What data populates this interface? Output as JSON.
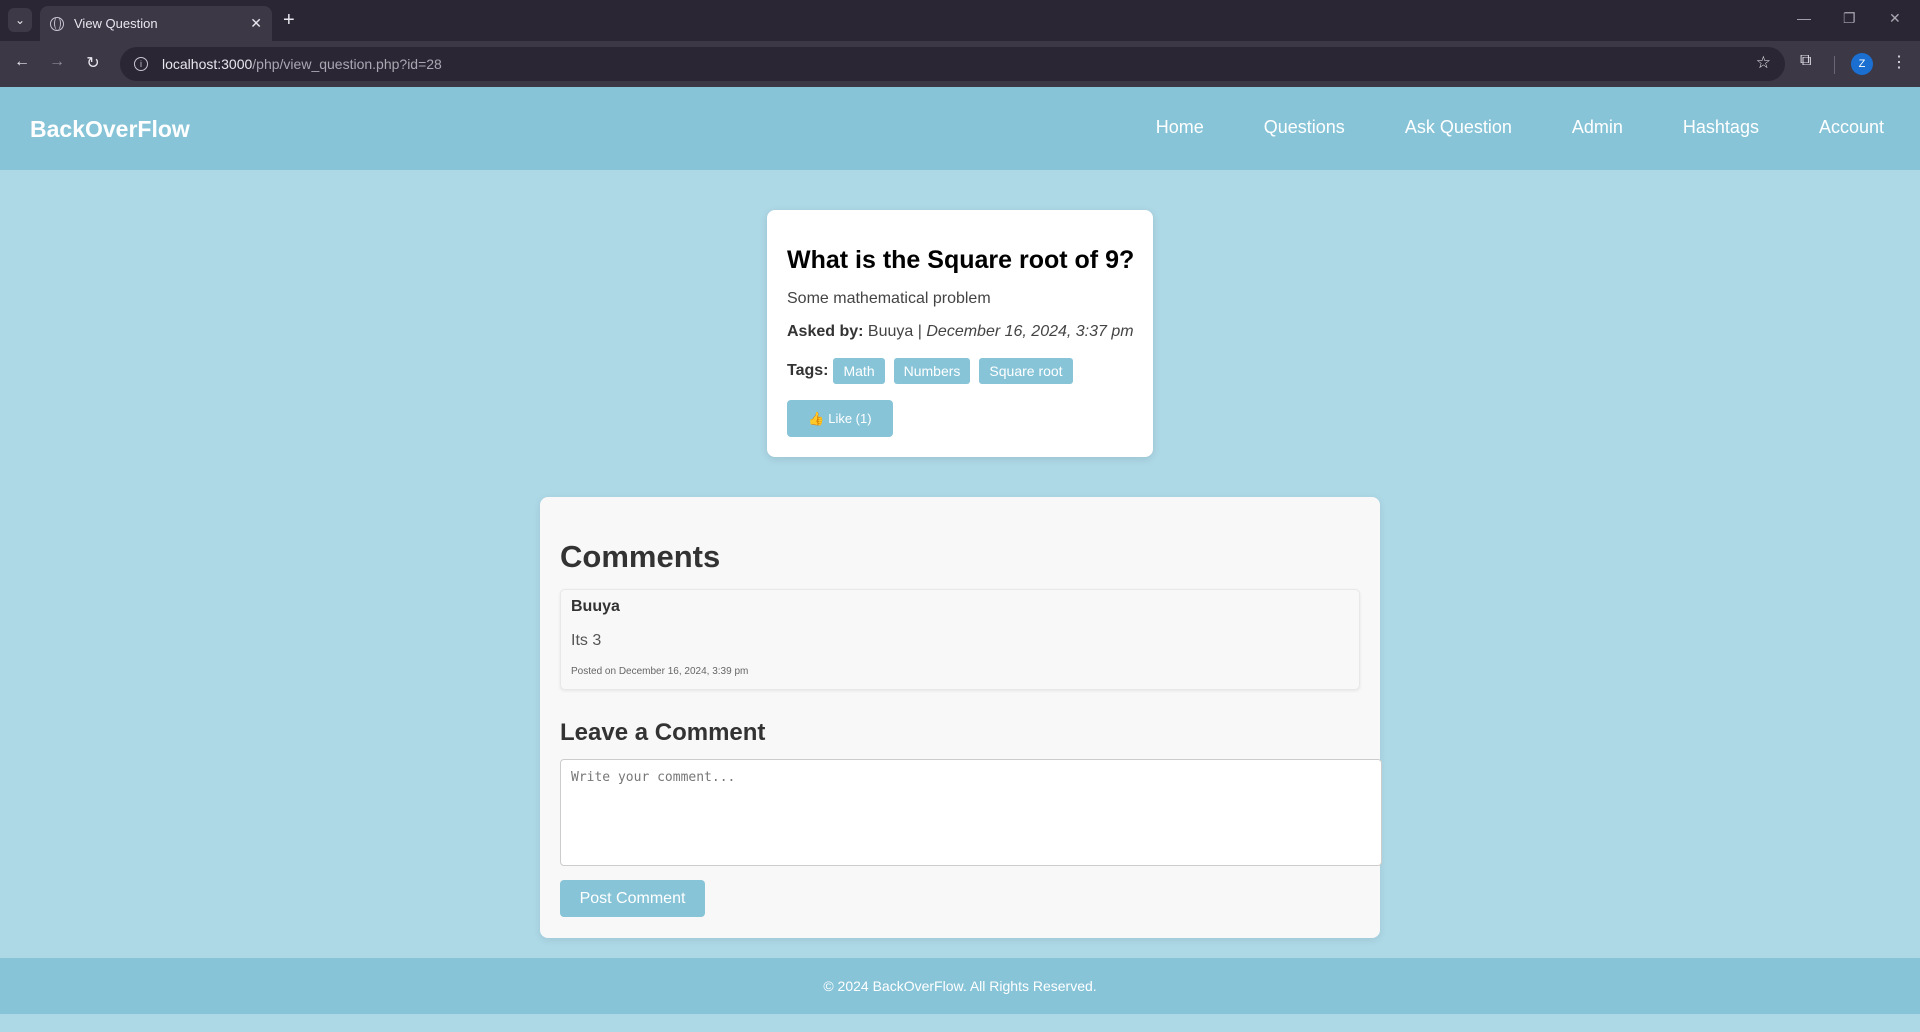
{
  "browser": {
    "tab_title": "View Question",
    "url_host": "localhost:3000",
    "url_path": "/php/view_question.php?id=28",
    "profile_initial": "Z"
  },
  "header": {
    "logo": "BackOverFlow",
    "nav": [
      "Home",
      "Questions",
      "Ask Question",
      "Admin",
      "Hashtags",
      "Account"
    ]
  },
  "question": {
    "title": "What is the Square root of 9?",
    "body": "Some mathematical problem",
    "asked_by_label": "Asked by:",
    "author": "Buuya",
    "separator": "|",
    "date": "December 16, 2024, 3:37 pm",
    "tags_label": "Tags:",
    "tags": [
      "Math",
      "Numbers",
      "Square root"
    ],
    "like_label": "👍 Like (1)"
  },
  "comments": {
    "title": "Comments",
    "items": [
      {
        "author": "Buuya",
        "text": "Its 3",
        "date": "Posted on December 16, 2024, 3:39 pm"
      }
    ],
    "leave_title": "Leave a Comment",
    "placeholder": "Write your comment...",
    "post_label": "Post Comment"
  },
  "footer": {
    "text": "© 2024 BackOverFlow. All Rights Reserved."
  },
  "colors": {
    "accent": "#87c4d8",
    "background": "#add8e6"
  }
}
